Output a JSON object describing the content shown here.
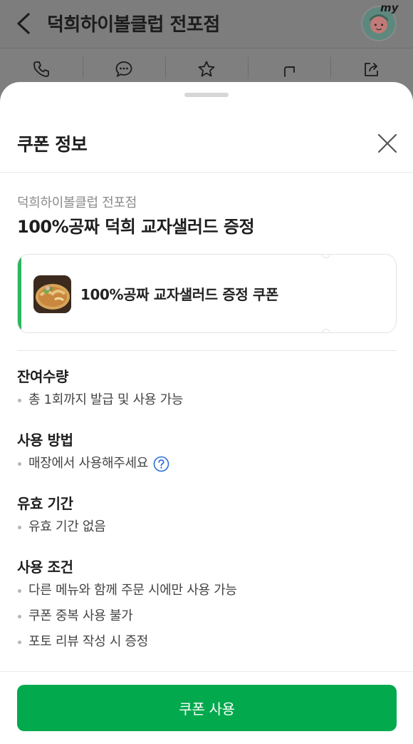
{
  "background_page": {
    "title": "덕희하이볼클럽 전포점",
    "my_label": "my",
    "actions": [
      {
        "icon": "phone-icon"
      },
      {
        "icon": "chat-icon"
      },
      {
        "icon": "star-icon"
      },
      {
        "icon": "directions-icon"
      },
      {
        "icon": "share-icon"
      }
    ]
  },
  "sheet": {
    "title": "쿠폰 정보",
    "store_name": "덕희하이볼클럽 전포점",
    "coupon_title": "100%공짜 덕희 교자샐러드 증정",
    "coupon_card": {
      "name": "100%공짜 교자샐러드 증정 쿠폰"
    },
    "sections": [
      {
        "title": "잔여수량",
        "items": [
          "총 1회까지 발급 및 사용 가능"
        ]
      },
      {
        "title": "사용 방법",
        "items": [
          "매장에서 사용해주세요"
        ]
      },
      {
        "title": "유효 기간",
        "items": [
          "유효 기간 없음"
        ]
      },
      {
        "title": "사용 조건",
        "items": [
          "다른 메뉴와 함께 주문 시에만 사용 가능",
          "쿠폰 중복 사용 불가",
          "포토 리뷰 작성 시 증정"
        ]
      }
    ],
    "use_button": "쿠폰 사용"
  },
  "colors": {
    "accent_green": "#2bb75e",
    "button_green": "#03a94d",
    "help_blue": "#2a6fd6"
  }
}
